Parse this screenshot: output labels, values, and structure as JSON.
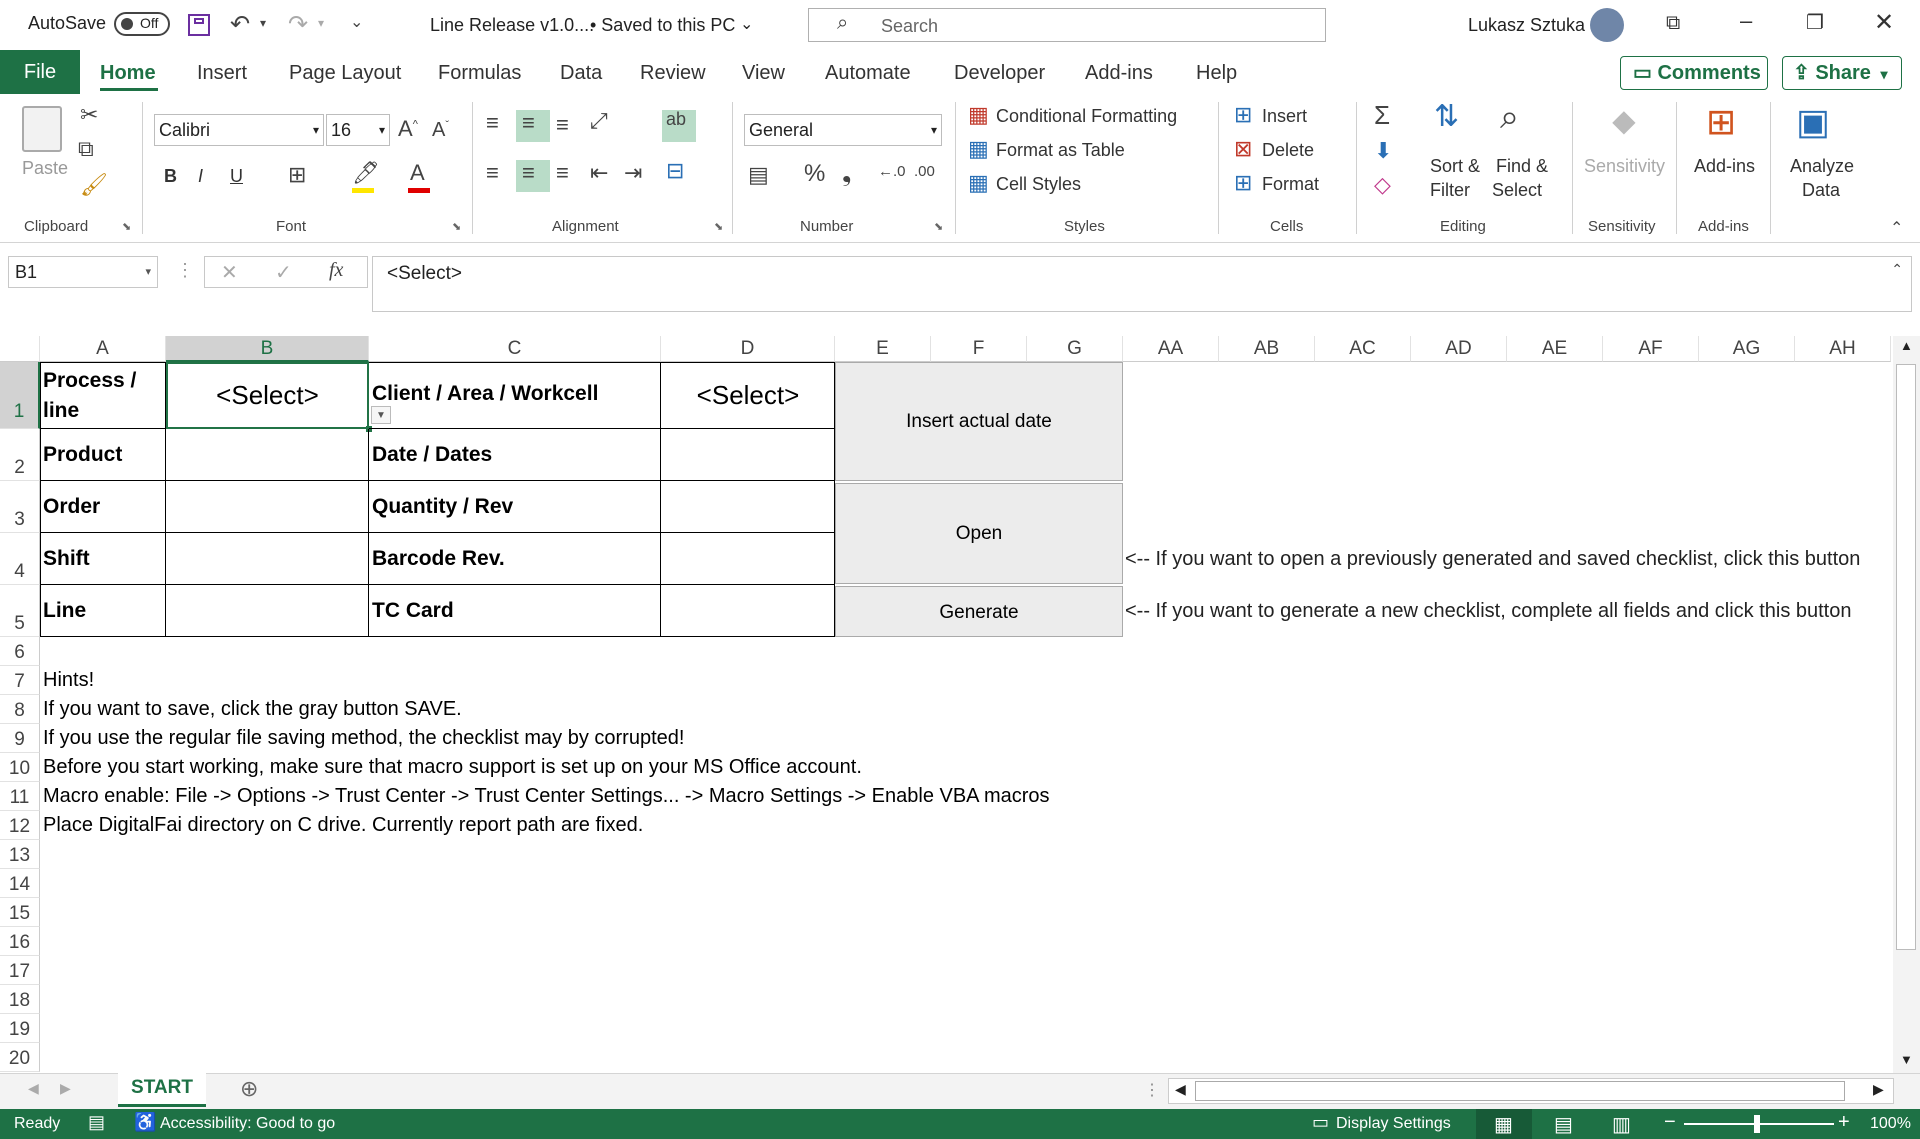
{
  "titlebar": {
    "autosave_label": "AutoSave",
    "autosave_state": "Off",
    "doc_title": "Line Release v1.0....",
    "save_status": "• Saved to this PC",
    "search_placeholder": "Search",
    "user_name": "Lukasz Sztuka"
  },
  "tabs": {
    "file": "File",
    "items": [
      "Home",
      "Insert",
      "Page Layout",
      "Formulas",
      "Data",
      "Review",
      "View",
      "Automate",
      "Developer",
      "Add-ins",
      "Help"
    ],
    "comments": "Comments",
    "share": "Share"
  },
  "ribbon": {
    "clipboard": {
      "paste": "Paste",
      "label": "Clipboard"
    },
    "font": {
      "name": "Calibri",
      "size": "16",
      "label": "Font",
      "bold": "B",
      "italic": "I",
      "underline": "U"
    },
    "alignment": {
      "label": "Alignment"
    },
    "number": {
      "format": "General",
      "label": "Number"
    },
    "styles": {
      "conditional": "Conditional Formatting",
      "format_table": "Format as Table",
      "cell_styles": "Cell Styles",
      "label": "Styles"
    },
    "cells": {
      "insert": "Insert",
      "delete": "Delete",
      "format": "Format",
      "label": "Cells"
    },
    "editing": {
      "sort1": "Sort &",
      "sort2": "Filter",
      "find1": "Find &",
      "find2": "Select",
      "label": "Editing"
    },
    "sensitivity": {
      "button": "Sensitivity",
      "label": "Sensitivity"
    },
    "addins": {
      "button": "Add-ins",
      "label": "Add-ins"
    },
    "analyze": {
      "line1": "Analyze",
      "line2": "Data"
    }
  },
  "formula_bar": {
    "name_box": "B1",
    "content": "<Select>"
  },
  "columns": [
    "A",
    "B",
    "C",
    "D",
    "E",
    "F",
    "G",
    "AA",
    "AB",
    "AC",
    "AD",
    "AE",
    "AF",
    "AG",
    "AH"
  ],
  "rows": [
    "1",
    "2",
    "3",
    "4",
    "5",
    "6",
    "7",
    "8",
    "9",
    "10",
    "11",
    "12",
    "13",
    "14",
    "15",
    "16",
    "17",
    "18",
    "19",
    "20"
  ],
  "table": {
    "a": [
      "Process / line",
      "Product",
      "Order",
      "Shift",
      "Line"
    ],
    "c": [
      "Client / Area / Workcell",
      "Date / Dates",
      "Quantity / Rev",
      "Barcode Rev.",
      "TC Card"
    ],
    "b1": "<Select>",
    "d1": "<Select>"
  },
  "buttons": {
    "insert_date": "Insert actual date",
    "open": "Open",
    "generate": "Generate"
  },
  "notes": {
    "open": "<-- If you want to open a previously generated and saved checklist, click this button",
    "generate": "<-- If you want to generate a new checklist, complete all fields and click this button"
  },
  "hints": [
    "Hints!",
    "If you want to save, click the gray button SAVE.",
    "If you use the regular file saving method, the checklist may by corrupted!",
    "Before you start working, make sure that macro support is set up on your MS Office account.",
    "Macro enable: File -> Options -> Trust Center -> Trust Center Settings... -> Macro Settings -> Enable VBA macros",
    "Place DigitalFai directory on C drive. Currently report path are fixed."
  ],
  "sheet_tab": "START",
  "status": {
    "ready": "Ready",
    "accessibility": "Accessibility: Good to go",
    "display_settings": "Display Settings",
    "zoom": "100%"
  },
  "colors": {
    "accent": "#1e7145",
    "selection": "#217346"
  }
}
